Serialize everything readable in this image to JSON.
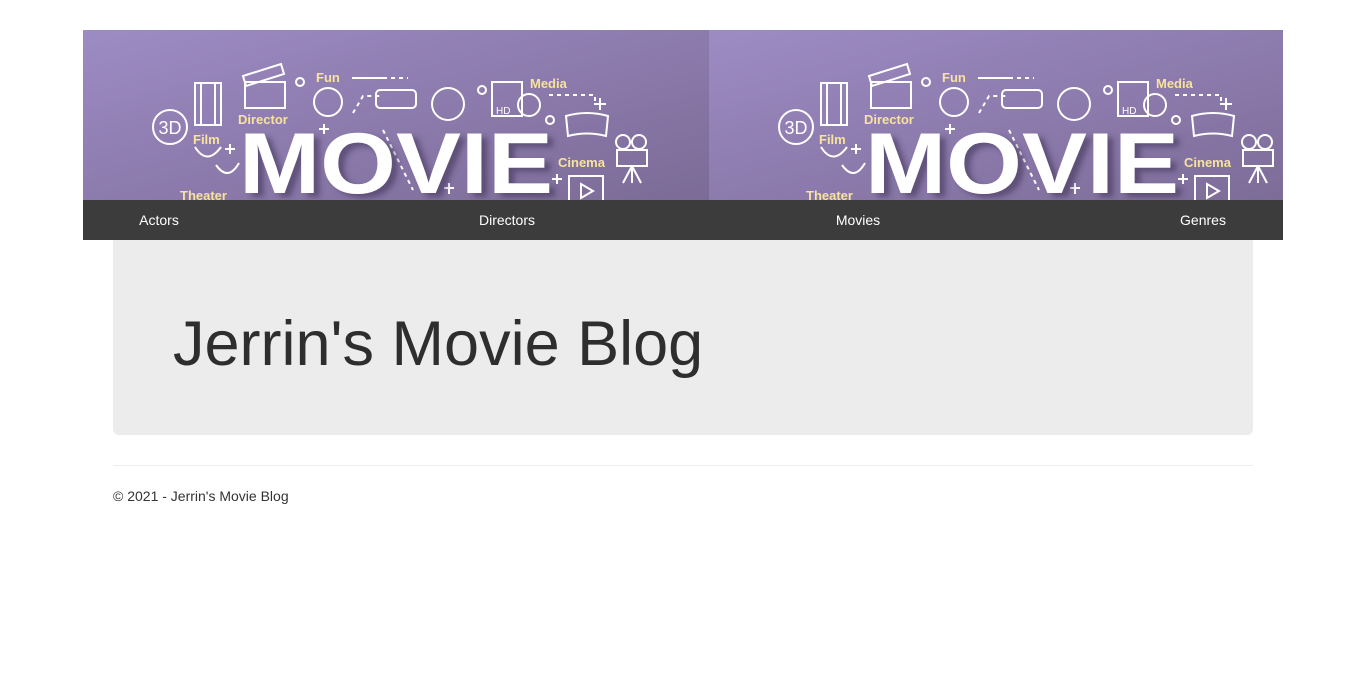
{
  "banner": {
    "big_word": "MOVIE",
    "words": {
      "fun": "Fun",
      "media": "Media",
      "director": "Director",
      "film": "Film",
      "cinema": "Cinema",
      "theater": "Theater",
      "three_d": "3D",
      "hd": "HD"
    },
    "colors": {
      "bg_light": "#9d8bc4",
      "bg_dark": "#7c6b96",
      "accent_text": "#f7e39a",
      "line": "#ffffff"
    },
    "icons": [
      "film-strip-icon",
      "clapperboard-icon",
      "clown-icon",
      "3d-glasses-icon",
      "film-reel-icon",
      "hd-disc-icon",
      "cinema-seats-icon",
      "movie-camera-icon",
      "theater-masks-icon",
      "play-icon"
    ]
  },
  "nav": {
    "items": [
      {
        "label": "Actors"
      },
      {
        "label": "Directors"
      },
      {
        "label": "Movies"
      },
      {
        "label": "Genres"
      }
    ]
  },
  "jumbotron": {
    "title": "Jerrin's Movie Blog"
  },
  "footer": {
    "text": "© 2021 - Jerrin's Movie Blog"
  }
}
